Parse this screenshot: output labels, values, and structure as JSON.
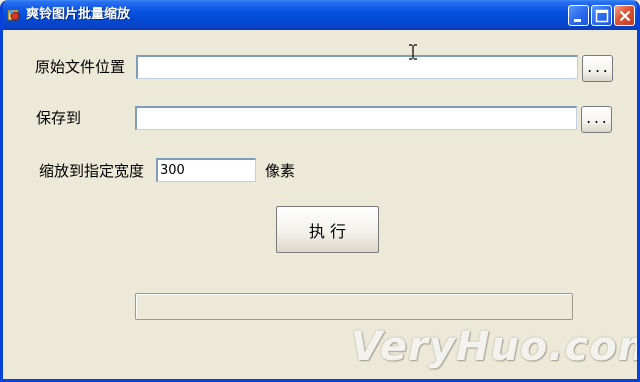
{
  "window": {
    "title": "爽铃图片批量缩放",
    "icon": "app-icon"
  },
  "titlebar_buttons": [
    "minimize-icon",
    "maximize-icon",
    "close-icon"
  ],
  "form": {
    "source_label": "原始文件位置",
    "source_value": "",
    "source_browse_label": "...",
    "save_label": "保存到",
    "save_value": "",
    "save_browse_label": "...",
    "width_label": "缩放到指定宽度",
    "width_value": "300",
    "width_unit": "像素",
    "execute_label": "执  行"
  },
  "progress": {
    "value": 0
  },
  "watermark": "VeryHuo.com",
  "colors": {
    "titlebar": "#0a55e3",
    "window_bg": "#ece9d8",
    "close_button": "#e0583a"
  }
}
